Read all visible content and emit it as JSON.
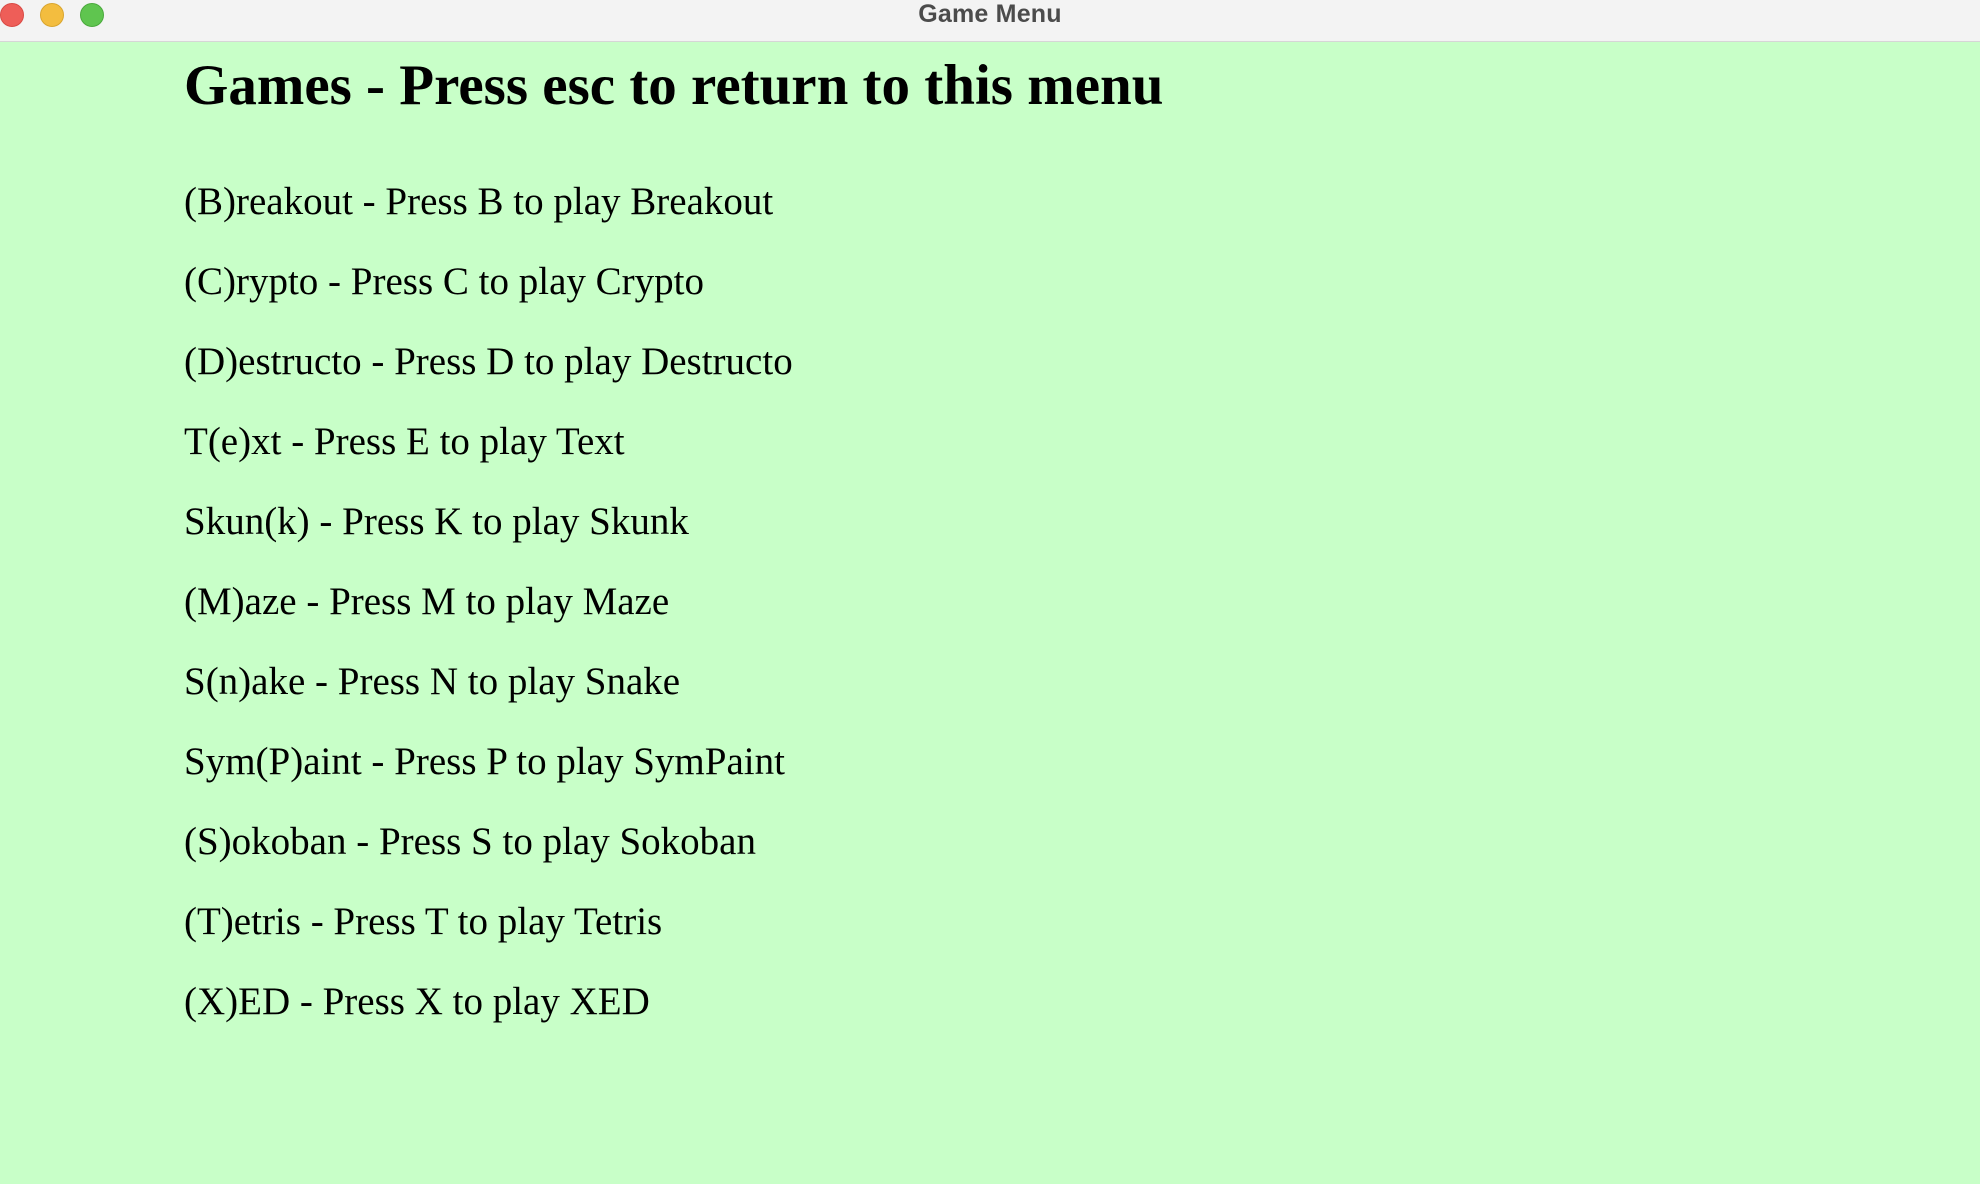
{
  "window": {
    "title": "Game Menu",
    "background_color": "#c8ffc8",
    "traffic_lights": {
      "close_color": "#ee5e58",
      "minimize_color": "#f3bd3f",
      "maximize_color": "#5fc54f"
    }
  },
  "page": {
    "heading": "Games - Press esc to return to this menu",
    "items": [
      {
        "label": "(B)reakout - Press B to play Breakout"
      },
      {
        "label": "(C)rypto - Press C to play Crypto"
      },
      {
        "label": "(D)estructo - Press D to play Destructo"
      },
      {
        "label": "T(e)xt - Press E to play Text"
      },
      {
        "label": "Skun(k) - Press K to play Skunk"
      },
      {
        "label": "(M)aze - Press M to play Maze"
      },
      {
        "label": "S(n)ake - Press N to play Snake"
      },
      {
        "label": "Sym(P)aint - Press P to play SymPaint"
      },
      {
        "label": "(S)okoban - Press S to play Sokoban"
      },
      {
        "label": "(T)etris - Press T to play Tetris"
      },
      {
        "label": "(X)ED - Press X to play XED"
      }
    ]
  }
}
